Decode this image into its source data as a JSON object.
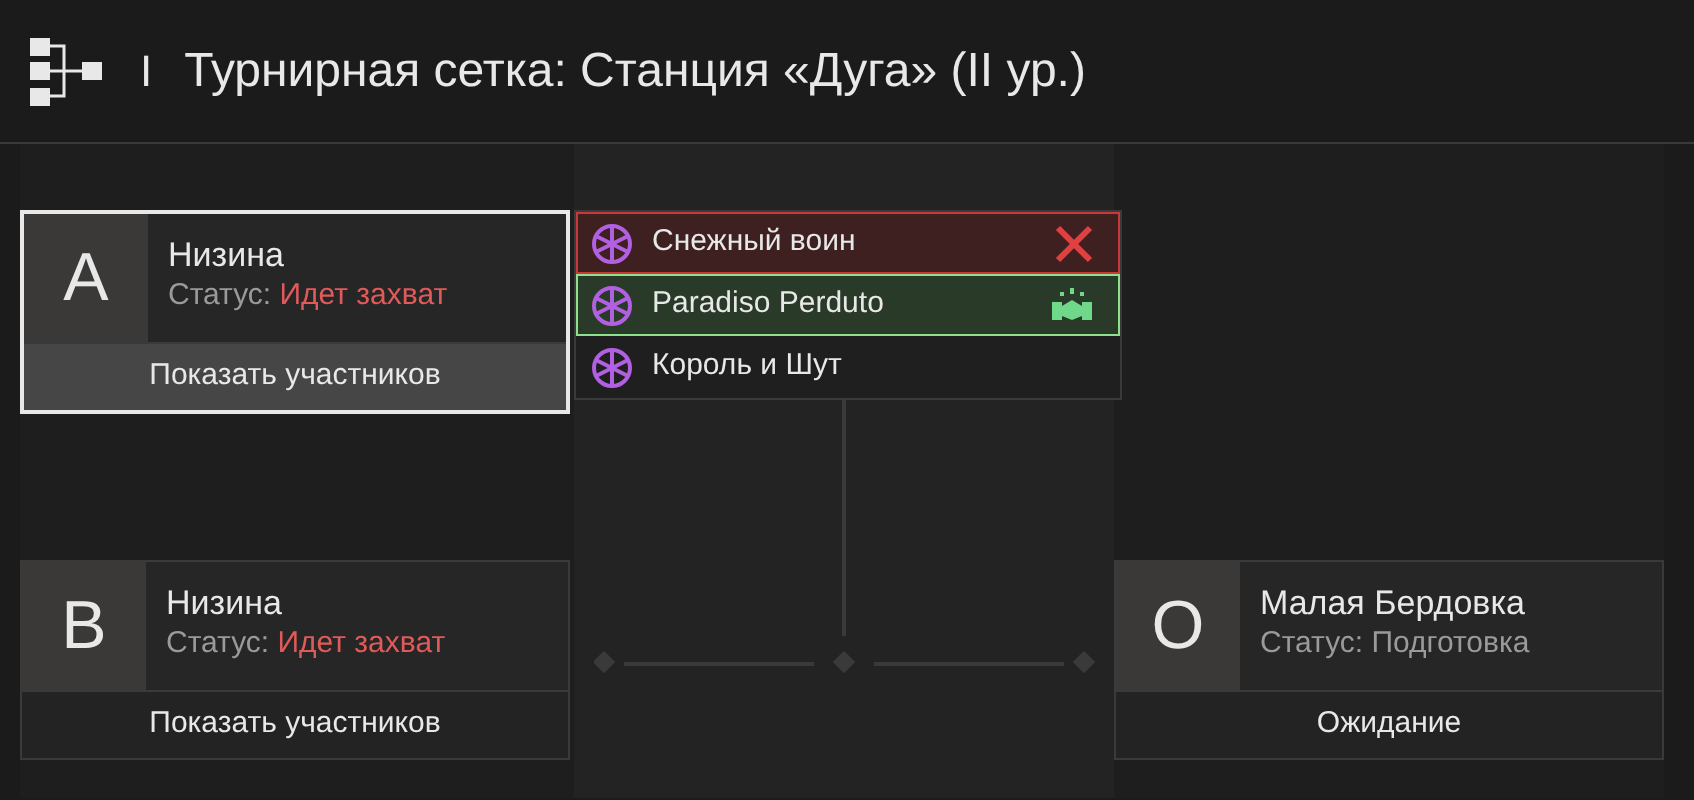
{
  "header": {
    "title": "Турнирная сетка: Станция «Дуга» (II ур.)",
    "separator": "I"
  },
  "left_column": [
    {
      "kind": "top",
      "letter": "A",
      "name": "Низина",
      "status_label": "Статус:",
      "status": "Идет захват",
      "color": "#e05a5a",
      "button": "Показать участников",
      "selected": true
    },
    {
      "kind": "bottom",
      "letter": "B",
      "name": "Низина",
      "status_label": "Статус:",
      "status": "Идет захват",
      "color": "#e05a5a",
      "button": "Показать участников",
      "selected": false
    }
  ],
  "right_column": [
    {
      "kind": "bottom",
      "letter": "O",
      "name": "Малая Бердовка",
      "status_label": "Статус:",
      "status": "Подготовка",
      "color": "#9a9a9a",
      "button": "Ожидание",
      "selected": false
    }
  ],
  "participants": [
    {
      "kind": "defeat",
      "name": "Снежный воин"
    },
    {
      "kind": "alliance",
      "name": "Paradiso Perduto"
    },
    {
      "kind": "none",
      "name": "Король и Шут"
    }
  ]
}
